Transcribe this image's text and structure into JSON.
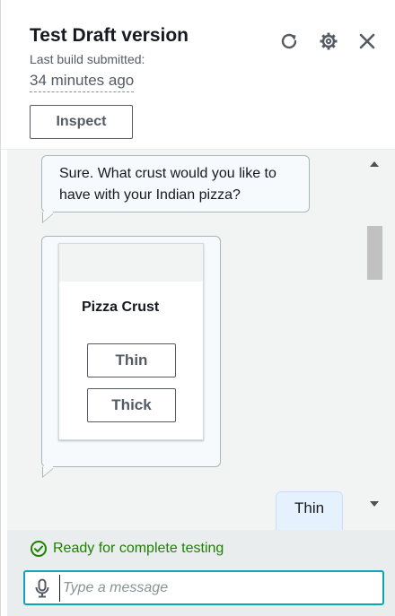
{
  "header": {
    "title": "Test Draft version",
    "subtitle": "Last build submitted:",
    "time": "34 minutes ago",
    "inspect_label": "Inspect",
    "icons": [
      "refresh-icon",
      "gear-icon",
      "close-icon"
    ]
  },
  "chat": {
    "bot_message": "Sure. What crust would you like to have with your Indian pizza?",
    "card": {
      "title": "Pizza Crust",
      "buttons": [
        "Thin",
        "Thick"
      ]
    },
    "user_message": "Thin"
  },
  "footer": {
    "status": "Ready for complete testing",
    "status_color": "#1d8102",
    "input_placeholder": "Type a message"
  }
}
